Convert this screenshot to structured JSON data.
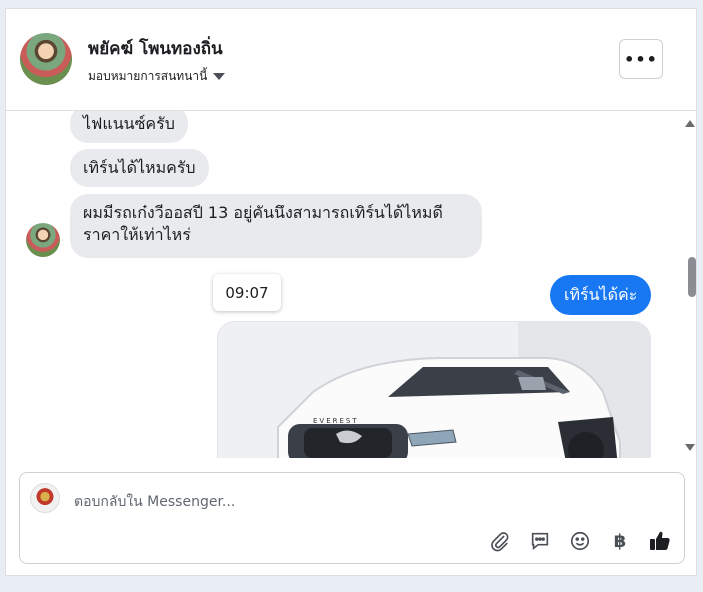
{
  "header": {
    "name": "พยัคฆ์ โพนทองถิ่น",
    "assign_label": "มอบหมายการสนทนานี้",
    "more_label": "•••"
  },
  "messages": {
    "incoming": [
      "ไฟแนนซ์ครับ",
      "เทิร์นได้ไหมครับ",
      "ผมมีรถเก๋งวีออสปี 13 อยู่คันนึงสามารถเทิร์นได้ไหมดี ราคาให้เท่าไหร่"
    ],
    "timestamp": "09:07",
    "outgoing": "เทิร์นได้ค่ะ",
    "photo_label": "EVEREST"
  },
  "composer": {
    "placeholder": "ตอบกลับใน Messenger..."
  },
  "icons": [
    "paperclip-icon",
    "chat-template-icon",
    "emoji-icon",
    "baht-icon",
    "thumbs-up-icon"
  ],
  "colors": {
    "accent": "#1877f2",
    "incoming_bubble": "#e9eaee"
  }
}
